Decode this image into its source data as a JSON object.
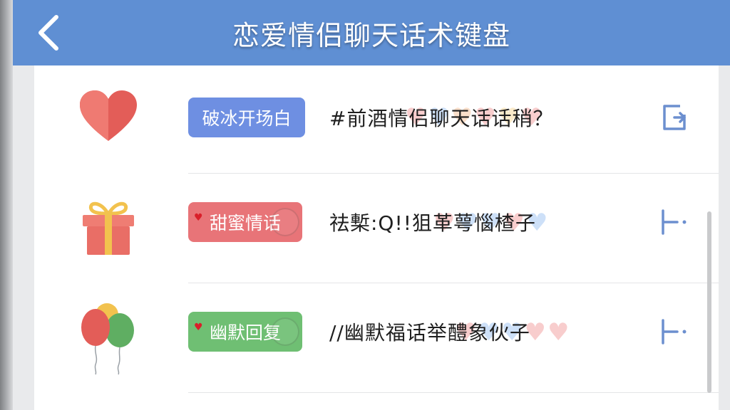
{
  "header": {
    "title": "恋爱情侣聊天话术键盘",
    "back_icon": "chevron-left-icon",
    "background": "#5f8fd3"
  },
  "rows": [
    {
      "icon": "heart-icon",
      "tag": "破冰开场白",
      "tag_color": "#6e8fe2",
      "phrase": "#前酒情侣聊天话话稍？",
      "action_icon": "insert-icon"
    },
    {
      "icon": "gift-icon",
      "tag": "甜蜜情话",
      "tag_color": "#e87478",
      "phrase": "祛槧:Q!!狙革萼惱楂子",
      "action_icon": "send-icon"
    },
    {
      "icon": "balloons-icon",
      "tag": "幽默回复",
      "tag_color": "#6fbf73",
      "phrase": "//幽默福话举醴象伙子",
      "action_icon": "send-icon"
    }
  ]
}
